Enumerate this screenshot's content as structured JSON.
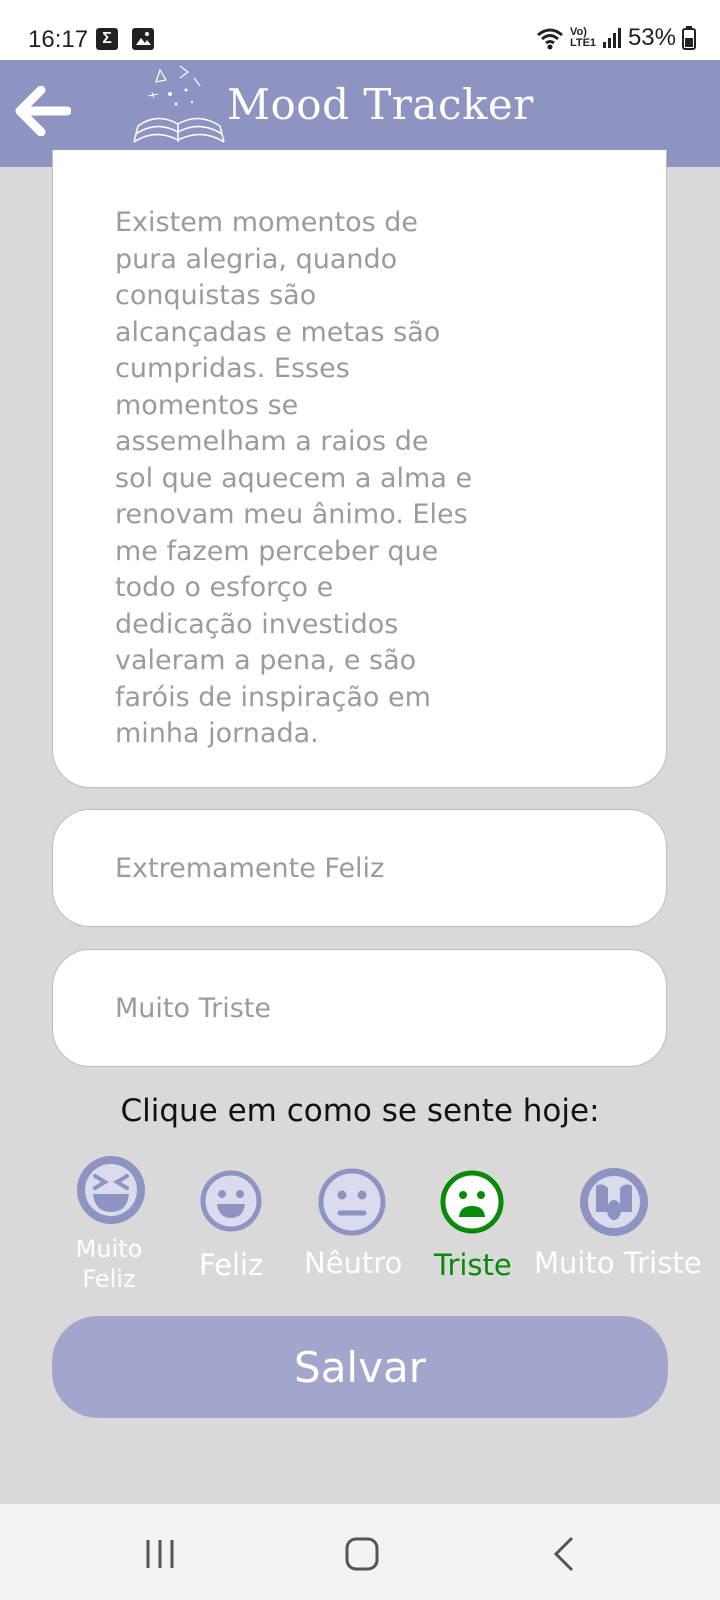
{
  "status_bar": {
    "time": "16:17",
    "notification_icons": [
      "sigma-icon",
      "image-icon"
    ],
    "network_label": "Vo) LTE1",
    "battery": "53%"
  },
  "header": {
    "title": "Mood Tracker",
    "back_icon": "arrow-left-icon",
    "logo_icon": "book-logo-icon",
    "background_color": "#8e94c1"
  },
  "form": {
    "description": "Existem momentos de pura alegria, quando conquistas são alcançadas e metas são cumpridas. Esses momentos se assemelham a raios de sol que aquecem a alma e renovam meu ânimo. Eles me fazem perceber que todo o esforço e dedicação investidos valeram a pena, e são faróis de inspiração em minha jornada.",
    "field_1": "Extremamente Feliz",
    "field_2": "Muito Triste"
  },
  "mood_prompt": "Clique em como se sente hoje:",
  "moods": [
    {
      "label": "Muito Feliz",
      "icon": "laughing-face-icon",
      "selected": false
    },
    {
      "label": "Feliz",
      "icon": "smiling-face-icon",
      "selected": false
    },
    {
      "label": "Nêutro",
      "icon": "neutral-face-icon",
      "selected": false
    },
    {
      "label": "Triste",
      "icon": "sad-face-icon",
      "selected": true
    },
    {
      "label": "Muito Triste",
      "icon": "crying-face-icon",
      "selected": false
    }
  ],
  "colors": {
    "mood_icon": "#8e94c1",
    "mood_selected": "#0a8a0a",
    "save_button": "#a3a6cc",
    "background": "#d9d9d9"
  },
  "save_label": "Salvar",
  "nav_bar": {
    "recents_icon": "recents-icon",
    "home_icon": "home-icon",
    "back_icon": "back-chevron-icon"
  }
}
